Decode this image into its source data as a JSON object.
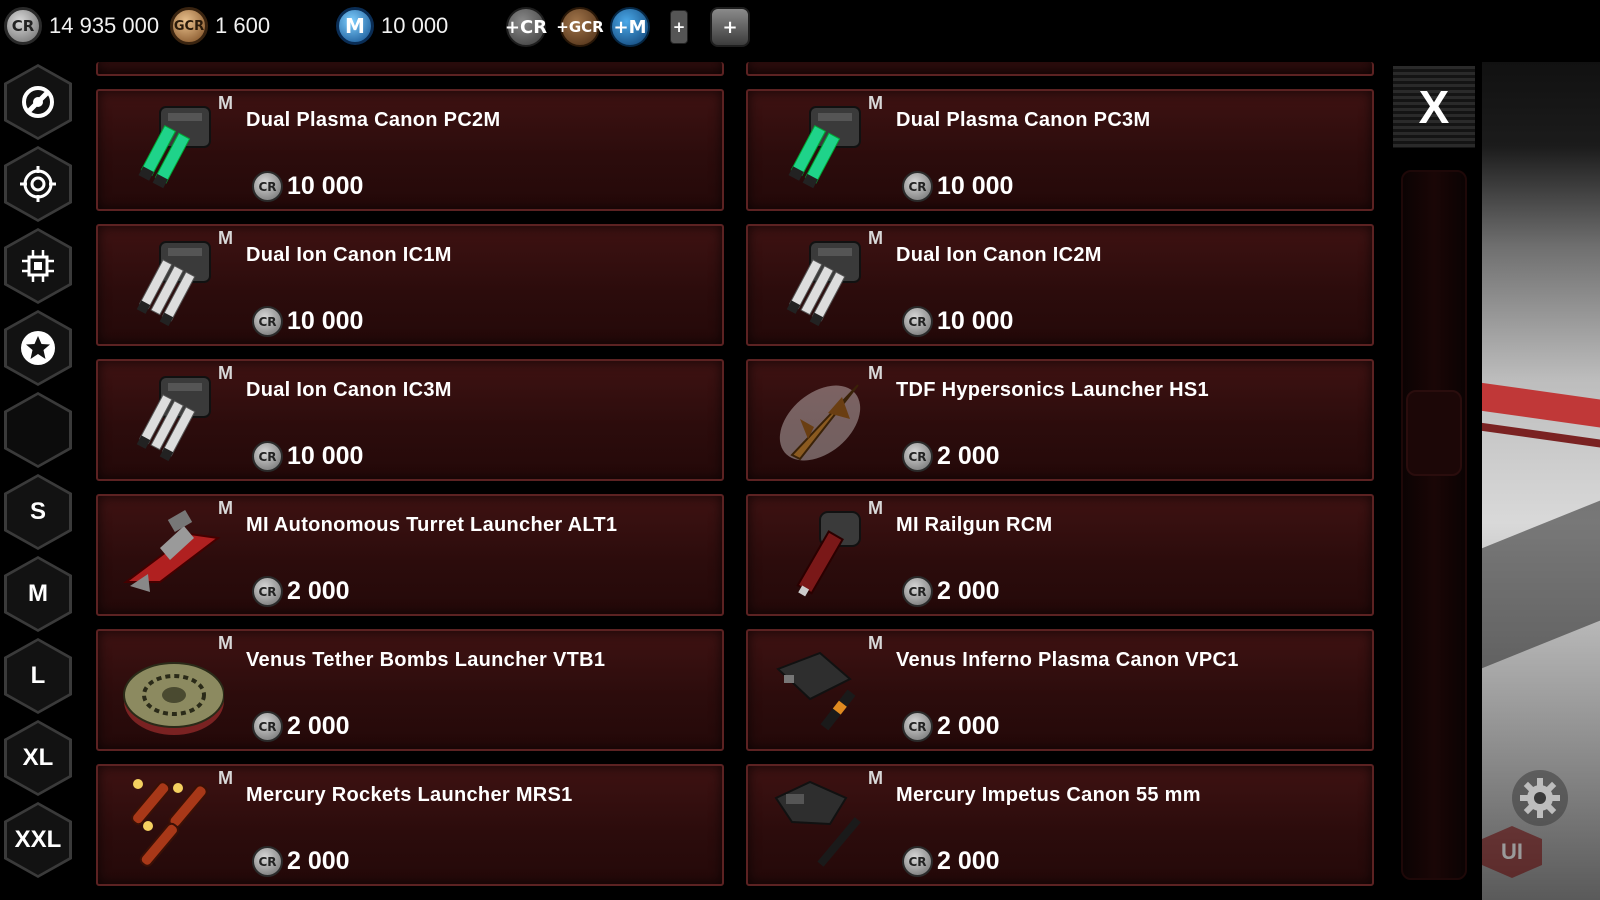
{
  "currencies": {
    "credits": {
      "icon": "CR",
      "value": "14 935 000"
    },
    "gold_credits": {
      "icon": "GCR",
      "value": "1 600"
    },
    "m_points": {
      "icon": "M",
      "value": "10 000"
    }
  },
  "top_buttons": [
    {
      "name": "add-credits-button",
      "icon": "+CR"
    },
    {
      "name": "add-gold-credits-button",
      "icon": "+GCR"
    },
    {
      "name": "add-m-points-button",
      "icon": "+M"
    },
    {
      "name": "add-item-button",
      "icon": "+"
    },
    {
      "name": "add-container-button",
      "icon": "+"
    }
  ],
  "sidebar": {
    "size_filters": [
      "S",
      "M",
      "L",
      "XL",
      "XXL"
    ]
  },
  "close_label": "X",
  "corner_ui_label": "UI",
  "price_icon": "CR",
  "items": [
    {
      "size": "M",
      "name": "Dual Plasma Canon PC2M",
      "price": "10 000",
      "thumb": "plasma-canon"
    },
    {
      "size": "M",
      "name": "Dual Plasma Canon PC3M",
      "price": "10 000",
      "thumb": "plasma-canon"
    },
    {
      "size": "M",
      "name": "Dual Ion Canon IC1M",
      "price": "10 000",
      "thumb": "ion-canon"
    },
    {
      "size": "M",
      "name": "Dual Ion Canon IC2M",
      "price": "10 000",
      "thumb": "ion-canon"
    },
    {
      "size": "M",
      "name": "Dual Ion Canon IC3M",
      "price": "10 000",
      "thumb": "ion-canon"
    },
    {
      "size": "M",
      "name": "TDF Hypersonics Launcher HS1",
      "price": "2 000",
      "thumb": "hypersonic-missile"
    },
    {
      "size": "M",
      "name": "MI Autonomous Turret Launcher ALT1",
      "price": "2 000",
      "thumb": "turret-launcher"
    },
    {
      "size": "M",
      "name": "MI Railgun RCM",
      "price": "2 000",
      "thumb": "railgun"
    },
    {
      "size": "M",
      "name": "Venus Tether Bombs Launcher VTB1",
      "price": "2 000",
      "thumb": "tether-bomb"
    },
    {
      "size": "M",
      "name": "Venus Inferno Plasma Canon VPC1",
      "price": "2 000",
      "thumb": "inferno-canon"
    },
    {
      "size": "M",
      "name": "Mercury Rockets Launcher MRS1",
      "price": "2 000",
      "thumb": "rockets"
    },
    {
      "size": "M",
      "name": "Mercury Impetus Canon 55 mm",
      "price": "2 000",
      "thumb": "impetus-canon"
    }
  ]
}
